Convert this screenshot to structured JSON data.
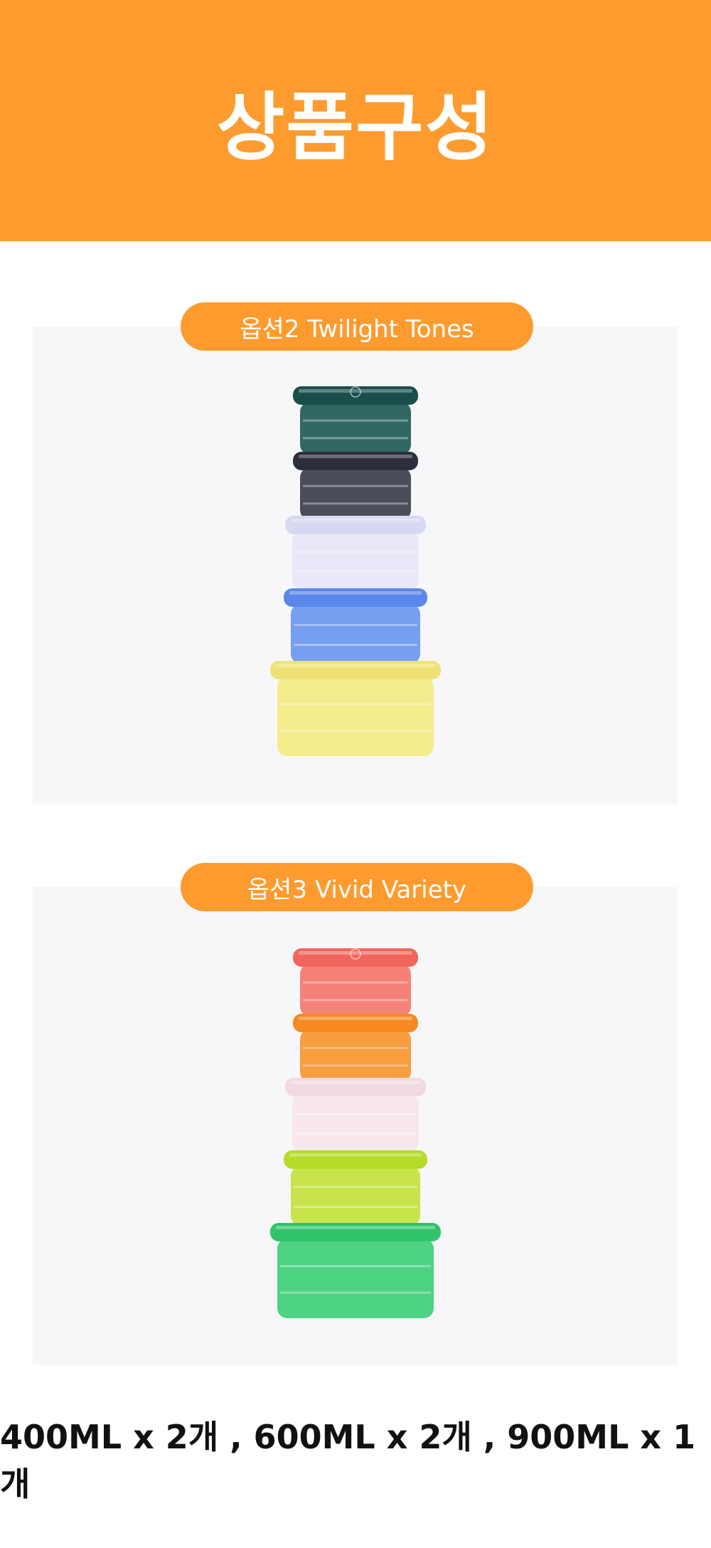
{
  "header": {
    "title": "상품구성"
  },
  "options": [
    {
      "label": "옵션2 Twilight Tones",
      "containers": [
        {
          "color": "#1f5a56",
          "lid": "#1a4e4a"
        },
        {
          "color": "#3b3f4c",
          "lid": "#2b2f3c"
        },
        {
          "color": "#e6e6f8",
          "lid": "#d7d9f2"
        },
        {
          "color": "#6b97f0",
          "lid": "#5a88ea"
        },
        {
          "color": "#f4ea82",
          "lid": "#eee276"
        }
      ]
    },
    {
      "label": "옵션3 Vivid Variety",
      "containers": [
        {
          "color": "#f4776c",
          "lid": "#f0665c"
        },
        {
          "color": "#f7962f",
          "lid": "#f48a20"
        },
        {
          "color": "#f6e4ea",
          "lid": "#f1d9e0"
        },
        {
          "color": "#c3e23b",
          "lid": "#b6db2a"
        },
        {
          "color": "#3ecf76",
          "lid": "#30c46a"
        }
      ]
    }
  ],
  "footer": {
    "text": "400ML x 2개 , 600ML x 2개 , 900ML x 1개"
  }
}
